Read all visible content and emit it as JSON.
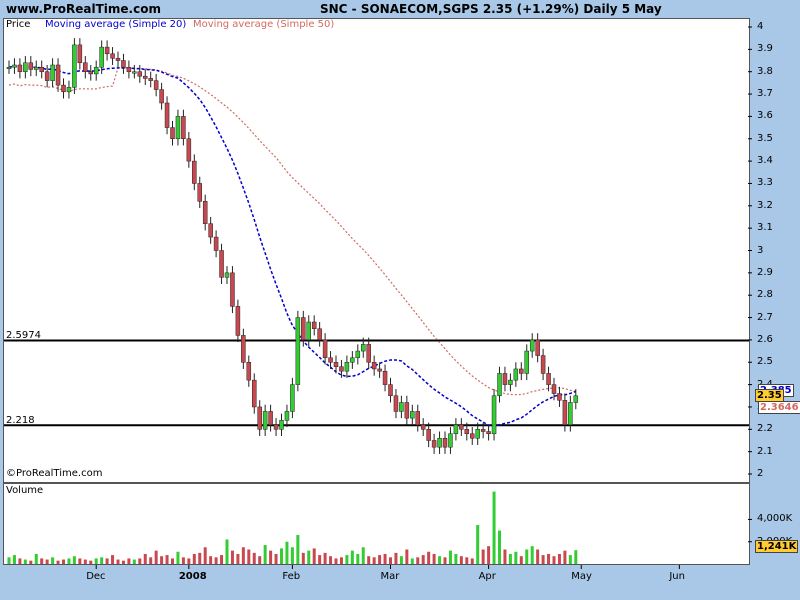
{
  "header": {
    "site": "www.ProRealTime.com",
    "title": "SNC - SONAECOM,SGPS    2.35 (+1.29%)    Daily  5 May"
  },
  "legend": {
    "price": "Price",
    "ma20": "Moving average (Simple 20)",
    "ma50": "Moving average (Simple 50)"
  },
  "volume_label": "Volume",
  "copyright": "©ProRealTime.com",
  "levels": [
    {
      "label": "2.5974",
      "value": 2.5974
    },
    {
      "label": "2.218",
      "value": 2.218
    }
  ],
  "badges": {
    "price": "2.35",
    "ma20": "2.385",
    "ma50": "2.3646",
    "volume": "1,241K"
  },
  "colors": {
    "up": "#33cc33",
    "down": "#c84850",
    "ma20": "#0000cc",
    "ma50": "#d06a60",
    "badge": "#ffcc33"
  },
  "chart_data": {
    "type": "candlestick",
    "y_ticks": [
      "4",
      "3.9",
      "3.8",
      "3.7",
      "3.6",
      "3.5",
      "3.4",
      "3.3",
      "3.2",
      "3.1",
      "3",
      "2.9",
      "2.8",
      "2.7",
      "2.6",
      "2.5",
      "2.4",
      "2.3",
      "2.2",
      "2.1",
      "2"
    ],
    "ylim": [
      2.0,
      4.0
    ],
    "x_ticks": [
      "Dec",
      "2008",
      "Feb",
      "Mar",
      "Apr",
      "May",
      "Jun"
    ],
    "volume_ticks": [
      "4,000K",
      "2,000K"
    ],
    "volume_ylim": [
      0,
      7000
    ],
    "close": [
      3.82,
      3.83,
      3.8,
      3.84,
      3.81,
      3.82,
      3.8,
      3.76,
      3.83,
      3.74,
      3.71,
      3.73,
      3.92,
      3.84,
      3.8,
      3.79,
      3.82,
      3.91,
      3.88,
      3.86,
      3.85,
      3.82,
      3.8,
      3.8,
      3.78,
      3.77,
      3.76,
      3.72,
      3.66,
      3.55,
      3.5,
      3.6,
      3.5,
      3.4,
      3.3,
      3.22,
      3.12,
      3.06,
      3.0,
      2.88,
      2.9,
      2.75,
      2.62,
      2.5,
      2.42,
      2.3,
      2.2,
      2.28,
      2.22,
      2.2,
      2.24,
      2.28,
      2.4,
      2.7,
      2.6,
      2.68,
      2.65,
      2.6,
      2.52,
      2.5,
      2.48,
      2.46,
      2.5,
      2.52,
      2.55,
      2.58,
      2.5,
      2.47,
      2.46,
      2.4,
      2.35,
      2.28,
      2.32,
      2.25,
      2.28,
      2.22,
      2.2,
      2.15,
      2.12,
      2.16,
      2.12,
      2.18,
      2.22,
      2.2,
      2.18,
      2.16,
      2.2,
      2.19,
      2.18,
      2.35,
      2.45,
      2.4,
      2.42,
      2.47,
      2.45,
      2.55,
      2.6,
      2.53,
      2.45,
      2.4,
      2.36,
      2.33,
      2.22,
      2.32,
      2.35
    ],
    "volume": [
      600,
      800,
      500,
      400,
      300,
      900,
      500,
      400,
      600,
      300,
      400,
      500,
      700,
      500,
      400,
      300,
      500,
      600,
      500,
      800,
      400,
      300,
      500,
      400,
      500,
      900,
      600,
      1200,
      700,
      800,
      500,
      1100,
      600,
      500,
      900,
      1000,
      1500,
      700,
      600,
      800,
      2200,
      1200,
      900,
      1500,
      1300,
      1000,
      700,
      1700,
      1200,
      900,
      1400,
      2000,
      1500,
      2600,
      1000,
      1200,
      1400,
      800,
      1000,
      700,
      500,
      600,
      800,
      1200,
      900,
      1500,
      700,
      600,
      800,
      900,
      600,
      1000,
      700,
      1300,
      500,
      600,
      800,
      1100,
      900,
      700,
      600,
      1200,
      900,
      700,
      600,
      500,
      3500,
      1300,
      1600,
      6500,
      3000,
      1300,
      900,
      1100,
      700,
      1300,
      1600,
      1300,
      800,
      900,
      700,
      900,
      1200,
      800,
      1241
    ]
  }
}
